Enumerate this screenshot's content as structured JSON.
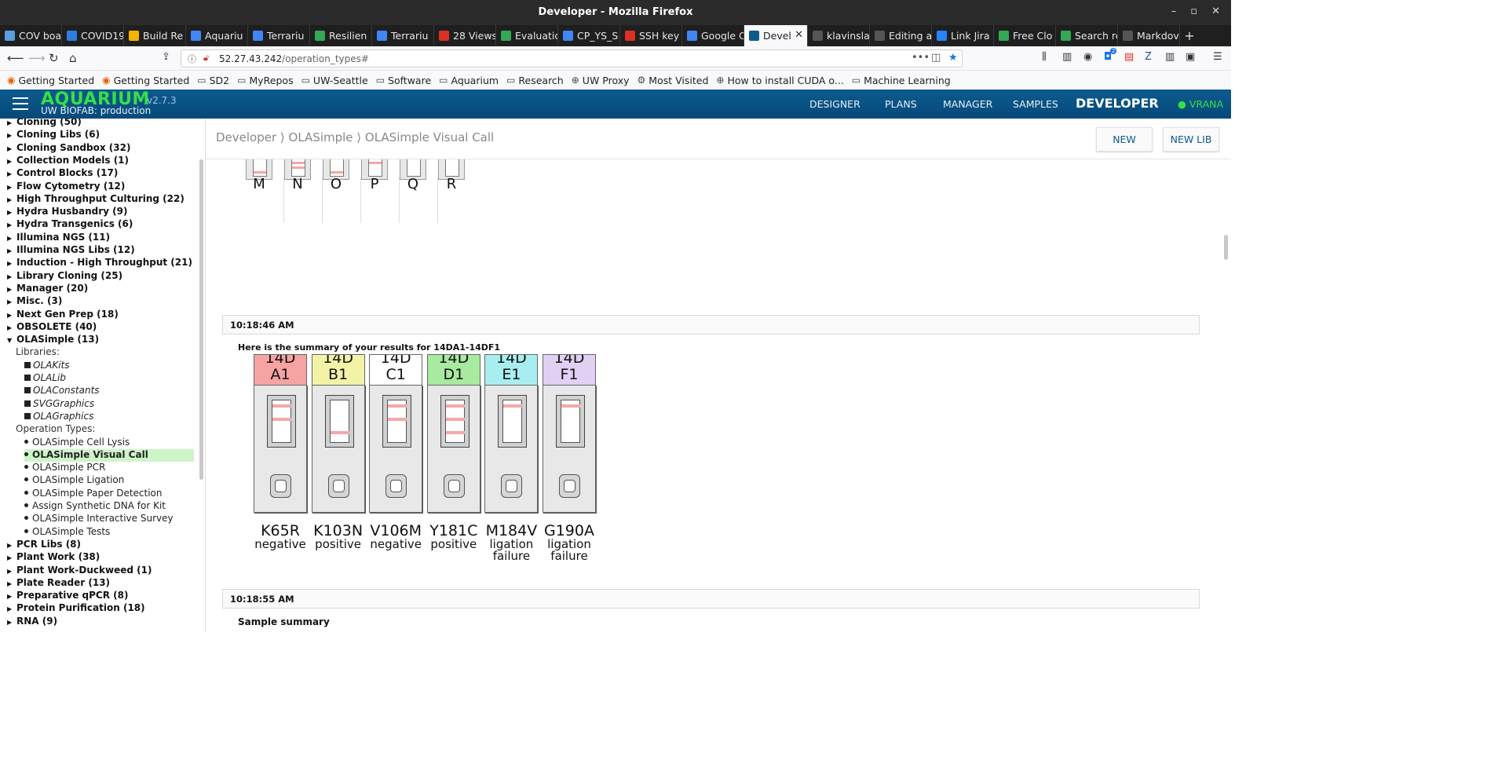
{
  "window": {
    "title": "Developer - Mozilla Firefox"
  },
  "tabs": [
    {
      "label": "COV boa",
      "color": "#5a9de0"
    },
    {
      "label": "COVID19",
      "color": "#2f7de1"
    },
    {
      "label": "Build Re",
      "color": "#f4b400"
    },
    {
      "label": "Aquariu",
      "color": "#4285f4"
    },
    {
      "label": "Terrariu",
      "color": "#4285f4"
    },
    {
      "label": "Resilien",
      "color": "#34a853"
    },
    {
      "label": "Terrariu",
      "color": "#4285f4"
    },
    {
      "label": "28 Views",
      "color": "#d93025"
    },
    {
      "label": "Evaluatio",
      "color": "#34a853"
    },
    {
      "label": "CP_YS_S",
      "color": "#4285f4"
    },
    {
      "label": "SSH key",
      "color": "#d93025"
    },
    {
      "label": "Google C",
      "color": "#4285f4"
    },
    {
      "label": "Devel",
      "color": "#0d5a8e",
      "active": true
    },
    {
      "label": "klavinsla",
      "color": "#555555"
    },
    {
      "label": "Editing a",
      "color": "#555555"
    },
    {
      "label": "Link Jira",
      "color": "#2684ff"
    },
    {
      "label": "Free Clo",
      "color": "#34a853"
    },
    {
      "label": "Search re",
      "color": "#34a853"
    },
    {
      "label": "Markdov",
      "color": "#555555"
    }
  ],
  "url": {
    "host": "52.27.43.242",
    "path": "/operation_types#"
  },
  "bookmarks": [
    "Getting Started",
    "Getting Started",
    "SD2",
    "MyRepos",
    "UW-Seattle",
    "Software",
    "Aquarium",
    "Research",
    "UW Proxy",
    "Most Visited",
    "How to install CUDA o...",
    "Machine Learning"
  ],
  "app": {
    "brand": "AQUARIUM",
    "version": "v2.7.3",
    "subtitle": "UW BIOFAB: production",
    "nav": [
      "DESIGNER",
      "PLANS",
      "MANAGER",
      "SAMPLES"
    ],
    "nav_active": "DEVELOPER",
    "user": "● VRANA"
  },
  "sidebar": {
    "categories_top": [
      "Cloning (50)",
      "Cloning Libs (6)",
      "Cloning Sandbox (32)",
      "Collection Models (1)",
      "Control Blocks (17)",
      "Flow Cytometry (12)",
      "High Throughput Culturing (22)",
      "Hydra Husbandry (9)",
      "Hydra Transgenics (6)",
      "Illumina NGS (11)",
      "Illumina NGS Libs (12)",
      "Induction - High Throughput (21)",
      "Library Cloning (25)",
      "Manager (20)",
      "Misc. (3)",
      "Next Gen Prep (18)",
      "OBSOLETE (40)"
    ],
    "open_category": "OLASimple (13)",
    "libraries_label": "Libraries:",
    "libraries": [
      "OLAKits",
      "OLALib",
      "OLAConstants",
      "SVGGraphics",
      "OLAGraphics"
    ],
    "optypes_label": "Operation Types:",
    "operation_types": [
      "OLASimple Cell Lysis",
      "OLASimple Visual Call",
      "OLASimple PCR",
      "OLASimple Ligation",
      "OLASimple Paper Detection",
      "Assign Synthetic DNA for Kit",
      "OLASimple Interactive Survey",
      "OLASimple Tests"
    ],
    "active_op": 1,
    "categories_bottom": [
      "PCR Libs (8)",
      "Plant Work (38)",
      "Plant Work-Duckweed (1)",
      "Plate Reader (13)",
      "Preparative qPCR (8)",
      "Protein Purification (18)",
      "RNA (9)"
    ]
  },
  "main": {
    "breadcrumb": "Developer ⟩ OLASimple ⟩ OLASimple Visual Call",
    "new_button": "NEW",
    "newlib_button": "NEW LIB",
    "stub_letters": [
      "M",
      "N",
      "O",
      "P",
      "Q",
      "R"
    ],
    "log1_time": "10:18:46 AM",
    "summary_text": "Here is the summary of your results for 14DA1-14DF1",
    "strips": [
      {
        "id1": "14D",
        "id2": "A1",
        "color": "#f6a3a3",
        "lines": [
          1,
          2
        ],
        "mutation": "K65R",
        "result": "negative"
      },
      {
        "id1": "14D",
        "id2": "B1",
        "color": "#f3f3a8",
        "lines": [
          3
        ],
        "mutation": "K103N",
        "result": "positive"
      },
      {
        "id1": "14D",
        "id2": "C1",
        "color": "#ffffff",
        "lines": [
          1,
          2
        ],
        "mutation": "V106M",
        "result": "negative"
      },
      {
        "id1": "14D",
        "id2": "D1",
        "color": "#a8eaa0",
        "lines": [
          1,
          2,
          3
        ],
        "mutation": "Y181C",
        "result": "positive"
      },
      {
        "id1": "14D",
        "id2": "E1",
        "color": "#a8eef0",
        "lines": [
          1
        ],
        "mutation": "M184V",
        "result": "ligation failure"
      },
      {
        "id1": "14D",
        "id2": "F1",
        "color": "#e2cff4",
        "lines": [
          1
        ],
        "mutation": "G190A",
        "result": "ligation failure"
      }
    ],
    "log2_time": "10:18:55 AM",
    "sample_summary": "Sample summary"
  }
}
